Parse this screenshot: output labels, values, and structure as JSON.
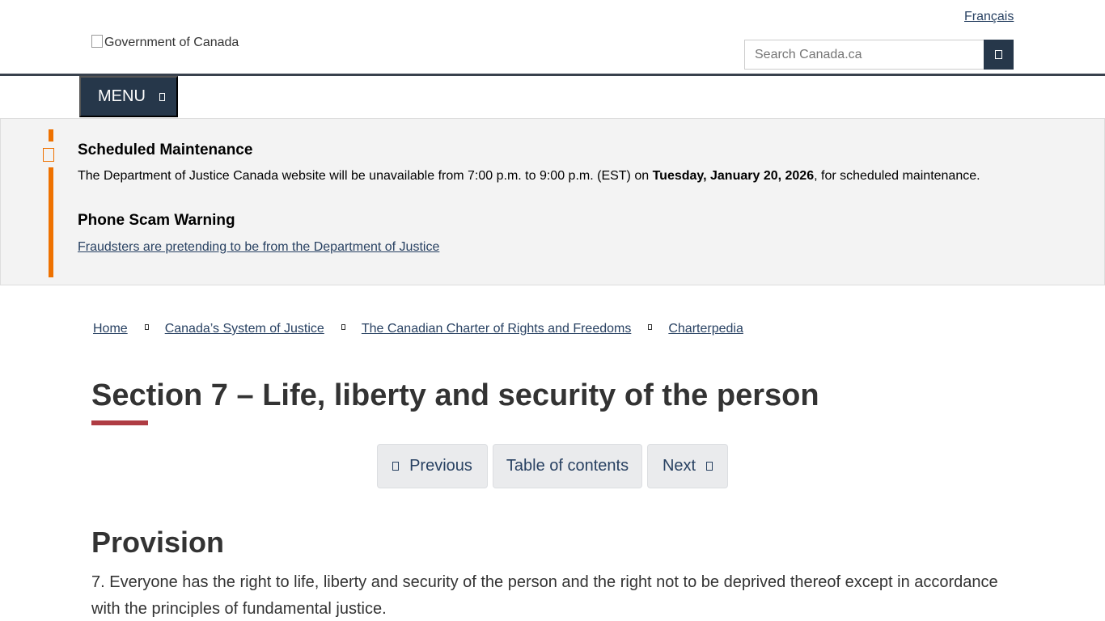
{
  "header": {
    "language_link": "Français",
    "logo_alt": "Government of Canada",
    "search_placeholder": "Search Canada.ca",
    "search_icon": "search-icon"
  },
  "menu": {
    "label": "MENU",
    "icon": "chevron-down-icon"
  },
  "alerts": {
    "accent_color": "#ee7100",
    "icon": "warning-icon",
    "maintenance_title": "Scheduled Maintenance",
    "maintenance_text_before": "The Department of Justice Canada website will be unavailable from 7:00 p.m. to 9:00 p.m. (EST) on ",
    "maintenance_date": "Tuesday, January 20, 2026",
    "maintenance_text_after": ", for scheduled maintenance.",
    "scam_title": "Phone Scam Warning",
    "scam_link": "Fraudsters are pretending to be from the Department of Justice"
  },
  "breadcrumb": [
    "Home",
    "Canada’s System of Justice",
    "The Canadian Charter of Rights and Freedoms",
    "Charterpedia"
  ],
  "page": {
    "title": "Section 7 – Life, liberty and security of the person",
    "title_accent_color": "#af3c43"
  },
  "pager": {
    "previous": "Previous",
    "toc": "Table of contents",
    "next": "Next"
  },
  "provision": {
    "heading": "Provision",
    "text": "7. Everyone has the right to life, liberty and security of the person and the right not to be deprived thereof except in accordance with the principles of fundamental justice."
  }
}
